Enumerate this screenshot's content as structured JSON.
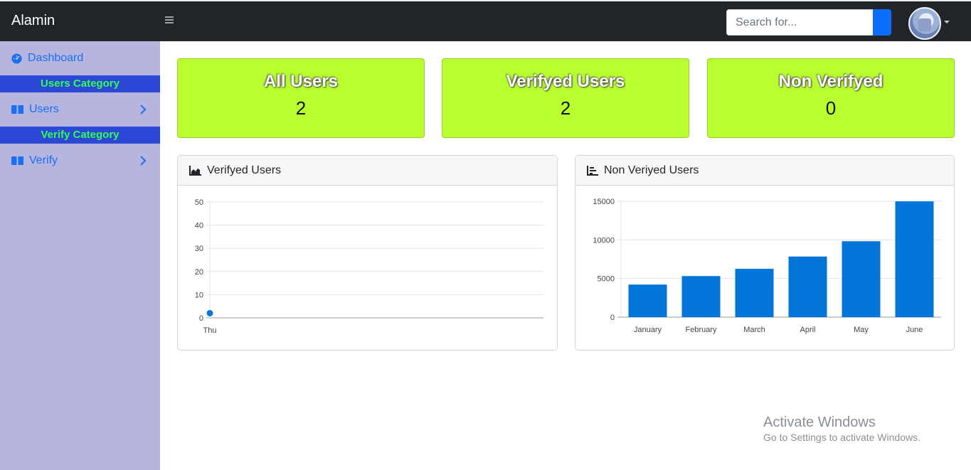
{
  "topbar": {
    "brand": "Alamin",
    "search_placeholder": "Search for..."
  },
  "sidebar": {
    "dashboard": "Dashboard",
    "users_category": "Users Category",
    "users": "Users",
    "verify_category": "Verify Category",
    "verify": "Verify"
  },
  "cards": [
    {
      "title": "All Users",
      "value": "2"
    },
    {
      "title": "Verifyed Users",
      "value": "2"
    },
    {
      "title": "Non Verifyed",
      "value": "0"
    }
  ],
  "panels": {
    "line_title": "Verifyed Users",
    "bar_title": "Non Veriyed Users"
  },
  "chart_data": [
    {
      "type": "line",
      "title": "Verifyed Users",
      "categories": [
        "Thu"
      ],
      "series": [
        {
          "values": [
            2
          ]
        }
      ],
      "ylim": [
        0,
        50
      ],
      "yticks": [
        0,
        10,
        20,
        30,
        40,
        50
      ],
      "color": "#0275d8",
      "grid": true
    },
    {
      "type": "bar",
      "title": "Non Veriyed Users",
      "categories": [
        "January",
        "February",
        "March",
        "April",
        "May",
        "June"
      ],
      "series": [
        {
          "values": [
            4215,
            5312,
            6251,
            7841,
            9821,
            14984
          ]
        }
      ],
      "ylim": [
        0,
        15000
      ],
      "yticks": [
        0,
        5000,
        10000,
        15000
      ],
      "color": "#0275d8",
      "grid": true
    }
  ],
  "watermark": {
    "line1": "Activate Windows",
    "line2": "Go to Settings to activate Windows."
  }
}
